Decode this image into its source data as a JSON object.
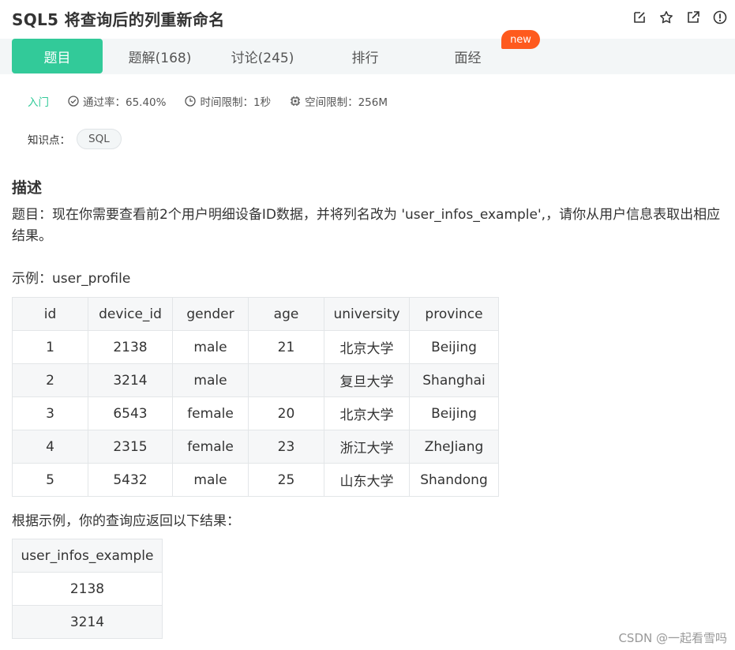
{
  "title": "SQL5  将查询后的列重新命名",
  "title_actions": [
    {
      "icon": "edit-icon"
    },
    {
      "icon": "star-icon"
    },
    {
      "icon": "external-link-icon"
    },
    {
      "icon": "report-icon"
    }
  ],
  "tabs": [
    {
      "label": "题目",
      "active": true
    },
    {
      "label": "题解(168)",
      "active": false
    },
    {
      "label": "讨论(245)",
      "active": false
    },
    {
      "label": "排行",
      "active": false
    },
    {
      "label": "面经",
      "active": false
    }
  ],
  "new_badge": "new",
  "meta": {
    "level": "入门",
    "pass_rate": "通过率：65.40%",
    "time_limit": "时间限制：1秒",
    "space_limit": "空间限制：256M"
  },
  "knowledge": {
    "label": "知识点：",
    "tags": [
      "SQL"
    ]
  },
  "section_title": "描述",
  "description": "题目：现在你需要查看前2个用户明细设备ID数据，并将列名改为 'user_infos_example',，请你从用户信息表取出相应结果。",
  "example_label": "示例：user_profile",
  "example_table": {
    "columns": [
      "id",
      "device_id",
      "gender",
      "age",
      "university",
      "province"
    ],
    "rows": [
      [
        "1",
        "2138",
        "male",
        "21",
        "北京大学",
        "Beijing"
      ],
      [
        "2",
        "3214",
        "male",
        "",
        "复旦大学",
        "Shanghai"
      ],
      [
        "3",
        "6543",
        "female",
        "20",
        "北京大学",
        "Beijing"
      ],
      [
        "4",
        "2315",
        "female",
        "23",
        "浙江大学",
        "ZheJiang"
      ],
      [
        "5",
        "5432",
        "male",
        "25",
        "山东大学",
        "Shandong"
      ]
    ]
  },
  "result_label": "根据示例，你的查询应返回以下结果：",
  "result_table": {
    "columns": [
      "user_infos_example"
    ],
    "rows": [
      [
        "2138"
      ],
      [
        "3214"
      ]
    ]
  },
  "watermark": "CSDN @一起看雪吗",
  "colors": {
    "accent": "#32ca99",
    "badge": "#fe5a1e",
    "tab_bar": "#f3f6f7"
  }
}
